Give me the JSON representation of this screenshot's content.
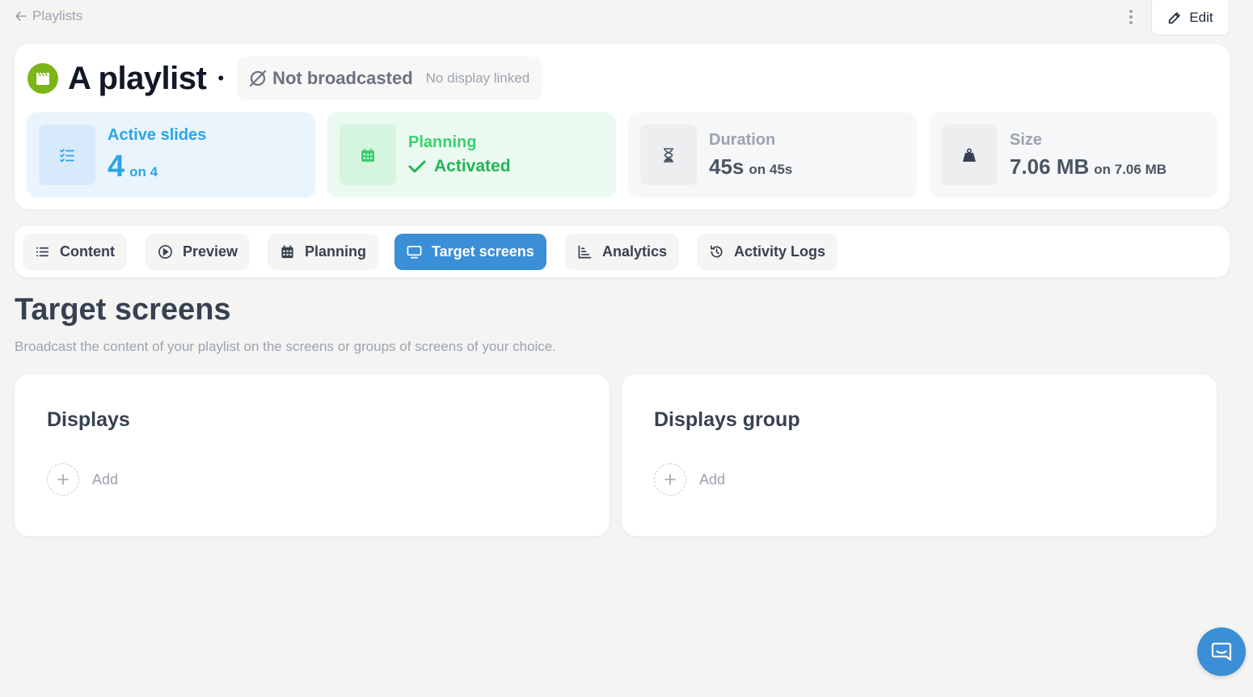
{
  "nav": {
    "back_label": "Playlists",
    "edit_label": "Edit"
  },
  "playlist": {
    "title": "A playlist",
    "broadcast_status": "Not broadcasted",
    "broadcast_note": "No display linked"
  },
  "stats": {
    "active_slides": {
      "label": "Active slides",
      "value": "4",
      "suffix": "on 4"
    },
    "planning": {
      "label": "Planning",
      "value": "Activated"
    },
    "duration": {
      "label": "Duration",
      "value": "45s",
      "suffix": "on 45s"
    },
    "size": {
      "label": "Size",
      "value": "7.06 MB",
      "suffix": "on 7.06 MB"
    }
  },
  "tabs": [
    {
      "label": "Content",
      "icon": "list-icon"
    },
    {
      "label": "Preview",
      "icon": "play-circle-icon"
    },
    {
      "label": "Planning",
      "icon": "calendar-icon"
    },
    {
      "label": "Target screens",
      "icon": "monitor-icon",
      "active": true
    },
    {
      "label": "Analytics",
      "icon": "bar-chart-icon"
    },
    {
      "label": "Activity Logs",
      "icon": "history-icon"
    }
  ],
  "section": {
    "title": "Target screens",
    "description": "Broadcast the content of your playlist on the screens or groups of screens of your choice."
  },
  "targets": {
    "displays": {
      "title": "Displays",
      "add_label": "Add"
    },
    "groups": {
      "title": "Displays group",
      "add_label": "Add"
    }
  },
  "colors": {
    "accent": "#3b8fd6",
    "logo": "#7cb518",
    "active_slides": "#2aa6e6",
    "planning": "#22b455"
  }
}
